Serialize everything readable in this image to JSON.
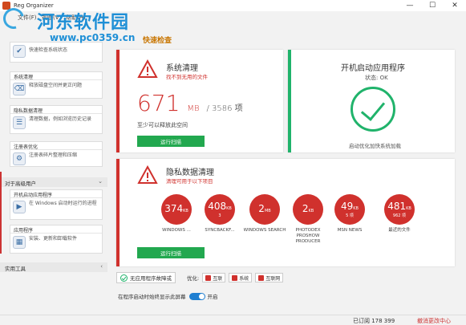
{
  "window": {
    "title": "Reg Organizer",
    "minimize": "—",
    "maximize": "☐",
    "close": "✕"
  },
  "watermark": {
    "title": "河东软件园",
    "url": "www.pc0359.cn"
  },
  "menu": {
    "items": [
      "文件(F)",
      "视图(V)",
      "帮助(H)"
    ],
    "scan_tab": "快速检查"
  },
  "sidebar": {
    "quick_check": "快速检查系统状态",
    "cards": [
      {
        "head": "系统清理",
        "text": "释放磁盘空间并更正问题"
      },
      {
        "head": "隐私数据清理",
        "text": "清理数据，例如浏览历史记录"
      },
      {
        "head": "注册表优化",
        "text": "注册表碎片整理和压缩"
      }
    ],
    "advanced_group": "对于高级用户",
    "advanced_cards": [
      {
        "head": "开机启动应用程序",
        "text": "在 Windows 启动时运行的进程"
      },
      {
        "head": "应用程序",
        "text": "安装、更新和卸载软件"
      }
    ],
    "tools_group": "实用工具"
  },
  "system_clean": {
    "title": "系统清理",
    "subtitle": "找不到无用的文件",
    "size": "671",
    "unit": "MB",
    "rest": "/ 3586 项",
    "desc": "至少可以释放此空间",
    "button": "运行扫描"
  },
  "startup": {
    "title": "开机启动应用程序",
    "status": "状态: OK",
    "desc": "启动优化加快系统加载"
  },
  "privacy": {
    "title": "隐私数据清理",
    "subtitle": "清理可用于以下项目",
    "button": "运行扫描",
    "items": [
      {
        "value": "374",
        "unit": "KB",
        "sub": "",
        "label": "WINDOWS ..."
      },
      {
        "value": "408",
        "unit": "KB",
        "sub": "3",
        "label": "SYNCBACKF..."
      },
      {
        "value": "2",
        "unit": "MB",
        "sub": "",
        "label": "WINDOWS SEARCH"
      },
      {
        "value": "2",
        "unit": "KB",
        "sub": "",
        "label": "PHOTODEX PROSHOW PRODUCER"
      },
      {
        "value": "49",
        "unit": "KB",
        "sub": "5 项",
        "label": "MSN NEWS"
      },
      {
        "value": "481",
        "unit": "KB",
        "sub": "962 项",
        "label": "最近的文件"
      }
    ]
  },
  "bottom": {
    "ok_text": "无应用程序故障或",
    "optimize_label": "优化:",
    "chips": [
      "互联",
      "系统",
      "互联网"
    ]
  },
  "toggle": {
    "label": "在程序启动时始终显示此屏幕",
    "state": "开启"
  },
  "statusbar": {
    "registered": "已订阅 178 399",
    "right": "撤消更改中心"
  },
  "colors": {
    "accent_red": "#d0312d",
    "accent_green": "#20b36b",
    "button_green": "#22a84f",
    "toggle_blue": "#1f7fd1"
  }
}
